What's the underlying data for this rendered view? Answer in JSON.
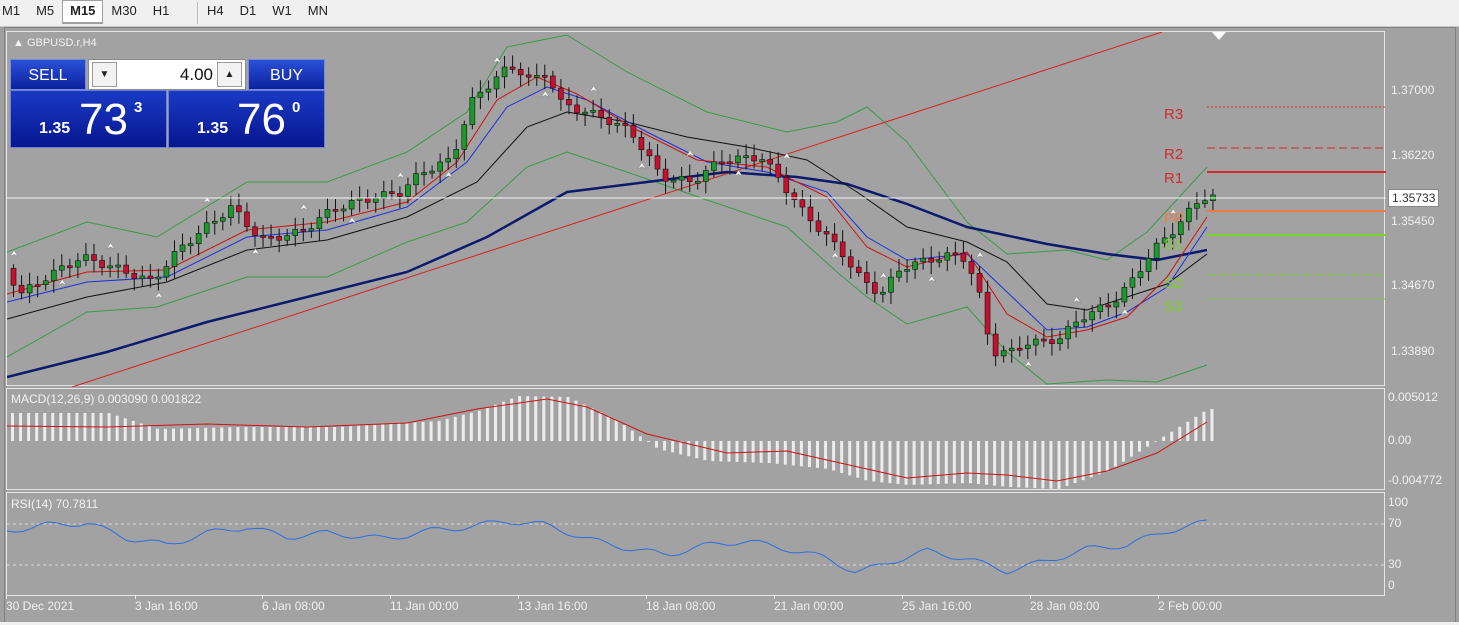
{
  "timeframes": [
    "M1",
    "M5",
    "M15",
    "M30",
    "H1",
    "H4",
    "D1",
    "W1",
    "MN"
  ],
  "active_timeframe": "M15",
  "symbol_label": "GBPUSD.r,H4",
  "trade_panel": {
    "sell_label": "SELL",
    "buy_label": "BUY",
    "lot_value": "4.00",
    "sell_price": {
      "prefix": "1.35",
      "big": "73",
      "sup": "3"
    },
    "buy_price": {
      "prefix": "1.35",
      "big": "76",
      "sup": "0"
    }
  },
  "price_axis": {
    "labels": [
      "1.37000",
      "1.36220",
      "1.35450",
      "1.34670",
      "1.33890"
    ],
    "current_price": "1.35733"
  },
  "pivots": [
    {
      "name": "R3",
      "color": "#d42a2a"
    },
    {
      "name": "R2",
      "color": "#d42a2a"
    },
    {
      "name": "R1",
      "color": "#d42a2a"
    },
    {
      "name": "PP",
      "color": "#ee7a44"
    },
    {
      "name": "S1",
      "color": "#7ad12a"
    },
    {
      "name": "S2",
      "color": "#7ad12a"
    },
    {
      "name": "S3",
      "color": "#7ad12a"
    }
  ],
  "macd": {
    "label": "MACD(12,26,9) 0.003090 0.001822",
    "axis_labels": [
      "0.005012",
      "0.00",
      "-0.004772"
    ]
  },
  "rsi": {
    "label": "RSI(14) 70.7811",
    "axis_labels": [
      "100",
      "70",
      "30",
      "0"
    ]
  },
  "time_axis": {
    "labels": [
      "30 Dec 2021",
      "3 Jan 16:00",
      "6 Jan 08:00",
      "11 Jan 00:00",
      "13 Jan 16:00",
      "18 Jan 08:00",
      "21 Jan 00:00",
      "25 Jan 16:00",
      "28 Jan 08:00",
      "2 Feb 00:00"
    ]
  },
  "colors": {
    "bull": "#1a9a2a",
    "bear": "#c8102e",
    "ma_slow": "#0c1a6e",
    "ma_fast_red": "#d01010",
    "ma_blue": "#1d2fe0",
    "bollinger": "#3a9a4a",
    "trendline": "#d82020",
    "rsi_line": "#2c6ee0",
    "macd_hist": "#ececec",
    "macd_signal": "#d01010"
  }
}
